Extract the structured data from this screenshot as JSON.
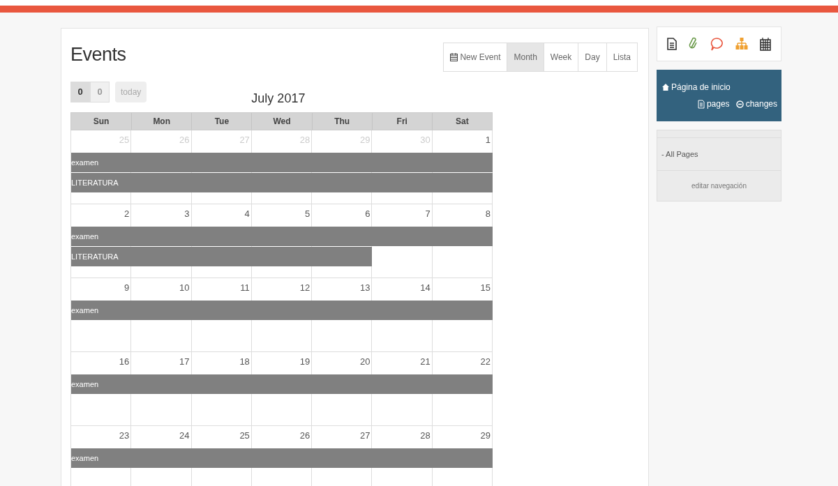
{
  "title": "Events",
  "nav_buttons": [
    {
      "label": "0",
      "selected": true
    },
    {
      "label": "0",
      "selected": false
    }
  ],
  "today_button": {
    "label": "today",
    "disabled": true
  },
  "month_title": "July 2017",
  "view_buttons": [
    {
      "kind": "new",
      "label": "New Event",
      "selected": false
    },
    {
      "kind": "view",
      "label": "Month",
      "selected": true
    },
    {
      "kind": "view",
      "label": "Week",
      "selected": false
    },
    {
      "kind": "view",
      "label": "Day",
      "selected": false
    },
    {
      "kind": "view",
      "label": "Lista",
      "selected": false
    }
  ],
  "weekdays": [
    "Sun",
    "Mon",
    "Tue",
    "Wed",
    "Thu",
    "Fri",
    "Sat"
  ],
  "weeks": [
    {
      "days": [
        {
          "label": "25",
          "other_month": true
        },
        {
          "label": "26",
          "other_month": true
        },
        {
          "label": "27",
          "other_month": true
        },
        {
          "label": "28",
          "other_month": true
        },
        {
          "label": "29",
          "other_month": true
        },
        {
          "label": "30",
          "other_month": true
        },
        {
          "label": "1",
          "other_month": false
        }
      ],
      "events": [
        {
          "title": "examen",
          "covers": [
            true,
            true,
            true,
            true,
            true,
            true,
            true
          ]
        },
        {
          "title": "LITERATURA",
          "covers": [
            true,
            true,
            true,
            true,
            true,
            true,
            true
          ]
        }
      ]
    },
    {
      "days": [
        {
          "label": "2",
          "other_month": false
        },
        {
          "label": "3",
          "other_month": false
        },
        {
          "label": "4",
          "other_month": false
        },
        {
          "label": "5",
          "other_month": false
        },
        {
          "label": "6",
          "other_month": false
        },
        {
          "label": "7",
          "other_month": false
        },
        {
          "label": "8",
          "other_month": false
        }
      ],
      "events": [
        {
          "title": "examen",
          "covers": [
            true,
            true,
            true,
            true,
            true,
            true,
            true
          ]
        },
        {
          "title": "LITERATURA",
          "covers": [
            true,
            true,
            true,
            true,
            true,
            false,
            false
          ]
        }
      ]
    },
    {
      "days": [
        {
          "label": "9",
          "other_month": false
        },
        {
          "label": "10",
          "other_month": false
        },
        {
          "label": "11",
          "other_month": false
        },
        {
          "label": "12",
          "other_month": false
        },
        {
          "label": "13",
          "other_month": false
        },
        {
          "label": "14",
          "other_month": false
        },
        {
          "label": "15",
          "other_month": false
        }
      ],
      "events": [
        {
          "title": "examen",
          "covers": [
            true,
            true,
            true,
            true,
            true,
            true,
            true
          ]
        }
      ]
    },
    {
      "days": [
        {
          "label": "16",
          "other_month": false
        },
        {
          "label": "17",
          "other_month": false
        },
        {
          "label": "18",
          "other_month": false
        },
        {
          "label": "19",
          "other_month": false
        },
        {
          "label": "20",
          "other_month": false
        },
        {
          "label": "21",
          "other_month": false
        },
        {
          "label": "22",
          "other_month": false
        }
      ],
      "events": [
        {
          "title": "examen",
          "covers": [
            true,
            true,
            true,
            true,
            true,
            true,
            true
          ]
        }
      ]
    },
    {
      "days": [
        {
          "label": "23",
          "other_month": false
        },
        {
          "label": "24",
          "other_month": false
        },
        {
          "label": "25",
          "other_month": false
        },
        {
          "label": "26",
          "other_month": false
        },
        {
          "label": "27",
          "other_month": false
        },
        {
          "label": "28",
          "other_month": false
        },
        {
          "label": "29",
          "other_month": false
        }
      ],
      "events": [
        {
          "title": "examen",
          "covers": [
            true,
            true,
            true,
            true,
            true,
            true,
            true
          ]
        }
      ]
    }
  ],
  "sidebar": {
    "home_link": "Página de inicio",
    "pages_link": "pages",
    "changes_link": "changes",
    "nav_items": [
      "- All Pages"
    ],
    "edit_link": "editar navegación"
  }
}
